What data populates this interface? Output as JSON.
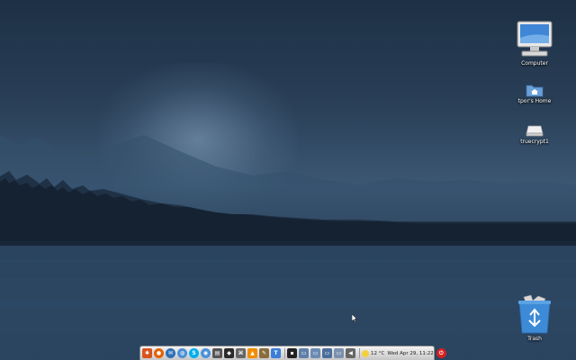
{
  "desktop": {
    "icons": [
      {
        "label": "Computer"
      },
      {
        "label": "tpor's Home"
      },
      {
        "label": "truecrypt1"
      },
      {
        "label": "Trash"
      }
    ]
  },
  "taskbar": {
    "apps": [
      {
        "name": "application-menu-icon",
        "color": "#d9531e"
      },
      {
        "name": "firefox-icon",
        "color": "#e66000"
      },
      {
        "name": "thunderbird-icon",
        "color": "#2e6fb7"
      },
      {
        "name": "globe-icon",
        "color": "#4a8fd6"
      },
      {
        "name": "skype-icon",
        "color": "#00aff0"
      },
      {
        "name": "chromium-icon",
        "color": "#4a90d9"
      },
      {
        "name": "terminal-emulator-icon",
        "color": "#555555"
      },
      {
        "name": "inkscape-icon",
        "color": "#2b2b2b"
      },
      {
        "name": "network-icon",
        "color": "#666666"
      },
      {
        "name": "vlc-icon",
        "color": "#f28c00"
      },
      {
        "name": "gimp-icon",
        "color": "#8a6d3b"
      },
      {
        "name": "text-editor-icon",
        "color": "#3b7dd8"
      },
      {
        "name": "terminal-icon",
        "color": "#222222"
      },
      {
        "name": "window-1-icon",
        "color": "#5f7fa8"
      },
      {
        "name": "window-2-icon",
        "color": "#6c8bb3"
      },
      {
        "name": "window-3-icon",
        "color": "#4b6e9c"
      },
      {
        "name": "window-4-icon",
        "color": "#7a90ad"
      },
      {
        "name": "volume-icon",
        "color": "#666666"
      }
    ],
    "weather": "12 °C",
    "clock": "Wed Apr 29, 11:22",
    "power_color": "#d62020"
  }
}
